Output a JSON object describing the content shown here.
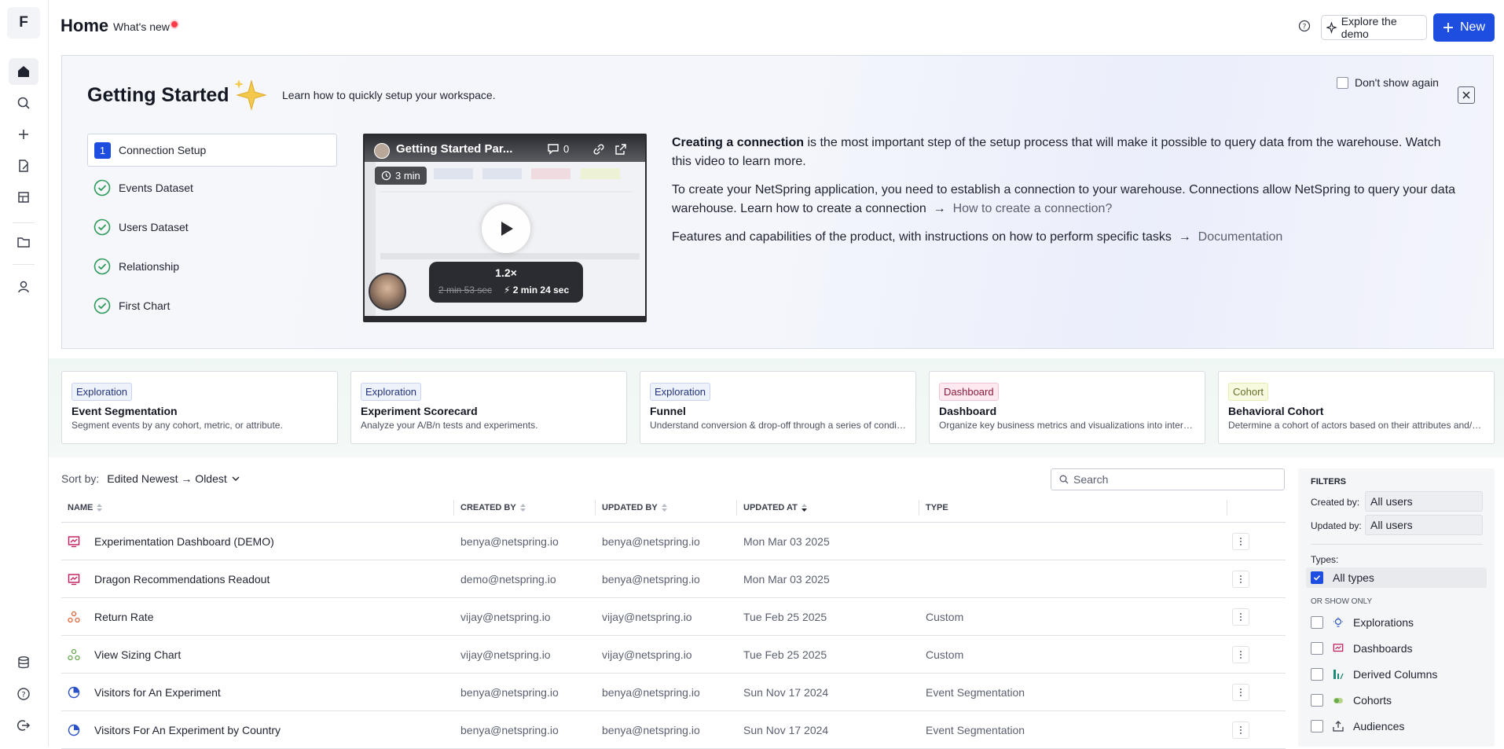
{
  "app": {
    "logo_letter": "F"
  },
  "header": {
    "title": "Home",
    "whats_new": "What's new",
    "explore_demo": "Explore the demo",
    "new_button": "New"
  },
  "sidebar": {
    "items": [
      {
        "icon": "home-icon",
        "active": true
      },
      {
        "icon": "search-icon"
      },
      {
        "icon": "plus-icon"
      },
      {
        "icon": "document-edit-icon"
      },
      {
        "icon": "catalog-icon"
      },
      {
        "icon": "folder-icon"
      },
      {
        "icon": "user-icon"
      },
      {
        "icon": "database-icon"
      },
      {
        "icon": "help-icon"
      },
      {
        "icon": "logout-icon"
      }
    ]
  },
  "getting_started": {
    "title": "Getting Started",
    "subtitle": "Learn how to quickly setup your workspace.",
    "dont_show": "Don't show again",
    "steps": [
      {
        "num": "1",
        "label": "Connection Setup",
        "active": true
      },
      {
        "label": "Events Dataset",
        "done": true
      },
      {
        "label": "Users Dataset",
        "done": true
      },
      {
        "label": "Relationship",
        "done": true
      },
      {
        "label": "First Chart",
        "done": true
      }
    ],
    "video": {
      "title": "Getting Started Par...",
      "comments": "0",
      "duration": "3 min",
      "speed": "1.2×",
      "old_time": "2 min 53 sec",
      "new_time": "⚡ 2 min 24 sec"
    },
    "para1_bold": "Creating a connection",
    "para1_rest": " is the most important step of the setup process that will make it possible to query data from the warehouse. Watch this video to learn more.",
    "para2": "To create your NetSpring application, you need to establish a connection to your warehouse. Connections allow NetSpring to query your data warehouse. Learn how to create a connection",
    "para2_link": "How to create a connection?",
    "para3": "Features and capabilities of the product, with instructions on how to perform specific tasks",
    "para3_link": "Documentation"
  },
  "templates": [
    {
      "badge": "Exploration",
      "kind": "expl",
      "title": "Event Segmentation",
      "desc": "Segment events by any cohort, metric, or attribute."
    },
    {
      "badge": "Exploration",
      "kind": "expl",
      "title": "Experiment Scorecard",
      "desc": "Analyze your A/B/n tests and experiments."
    },
    {
      "badge": "Exploration",
      "kind": "expl",
      "title": "Funnel",
      "desc": "Understand conversion & drop-off through a series of conditi..."
    },
    {
      "badge": "Dashboard",
      "kind": "dash",
      "title": "Dashboard",
      "desc": "Organize key business metrics and visualizations into interacti..."
    },
    {
      "badge": "Cohort",
      "kind": "coh",
      "title": "Behavioral Cohort",
      "desc": "Determine a cohort of actors based on their attributes and/or ..."
    }
  ],
  "list": {
    "sort_label": "Sort by:",
    "sort_value": "Edited Newest → Oldest",
    "search_placeholder": "Search",
    "columns": {
      "name": "NAME",
      "created_by": "CREATED BY",
      "updated_by": "UPDATED BY",
      "updated_at": "UPDATED AT",
      "type": "TYPE"
    },
    "rows": [
      {
        "icon": "dashboard-icon",
        "color": "#c2185b",
        "name": "Experimentation Dashboard (DEMO)",
        "created_by": "benya@netspring.io",
        "updated_by": "benya@netspring.io",
        "updated_at": "Mon Mar 03 2025",
        "type": ""
      },
      {
        "icon": "dashboard-icon",
        "color": "#c2185b",
        "name": "Dragon Recommendations Readout",
        "created_by": "demo@netspring.io",
        "updated_by": "benya@netspring.io",
        "updated_at": "Mon Mar 03 2025",
        "type": ""
      },
      {
        "icon": "custom-exploration-icon",
        "color": "#e0663a",
        "name": "Return Rate",
        "created_by": "vijay@netspring.io",
        "updated_by": "vijay@netspring.io",
        "updated_at": "Tue Feb 25 2025",
        "type": "Custom"
      },
      {
        "icon": "custom-exploration-icon",
        "color": "#6aa84f",
        "name": "View Sizing Chart",
        "created_by": "vijay@netspring.io",
        "updated_by": "vijay@netspring.io",
        "updated_at": "Tue Feb 25 2025",
        "type": "Custom"
      },
      {
        "icon": "event-segmentation-icon",
        "color": "#2b52c9",
        "name": "Visitors for An Experiment",
        "created_by": "benya@netspring.io",
        "updated_by": "benya@netspring.io",
        "updated_at": "Sun Nov 17 2024",
        "type": "Event Segmentation"
      },
      {
        "icon": "event-segmentation-icon",
        "color": "#2b52c9",
        "name": "Visitors For An Experiment by Country",
        "created_by": "benya@netspring.io",
        "updated_by": "benya@netspring.io",
        "updated_at": "Sun Nov 17 2024",
        "type": "Event Segmentation"
      }
    ]
  },
  "filters": {
    "title": "FILTERS",
    "created_by_label": "Created by:",
    "created_by_value": "All users",
    "updated_by_label": "Updated by:",
    "updated_by_value": "All users",
    "types_label": "Types:",
    "all_types": "All types",
    "or_show_only": "OR SHOW ONLY",
    "options": [
      {
        "label": "Explorations",
        "icon": "exploration-icon"
      },
      {
        "label": "Dashboards",
        "icon": "dashboard-icon"
      },
      {
        "label": "Derived Columns",
        "icon": "derived-column-icon"
      },
      {
        "label": "Cohorts",
        "icon": "cohort-icon"
      },
      {
        "label": "Audiences",
        "icon": "audience-icon"
      }
    ]
  },
  "colors": {
    "accent": "#1e4ee0",
    "notify_dot": "#ff3b4a"
  }
}
